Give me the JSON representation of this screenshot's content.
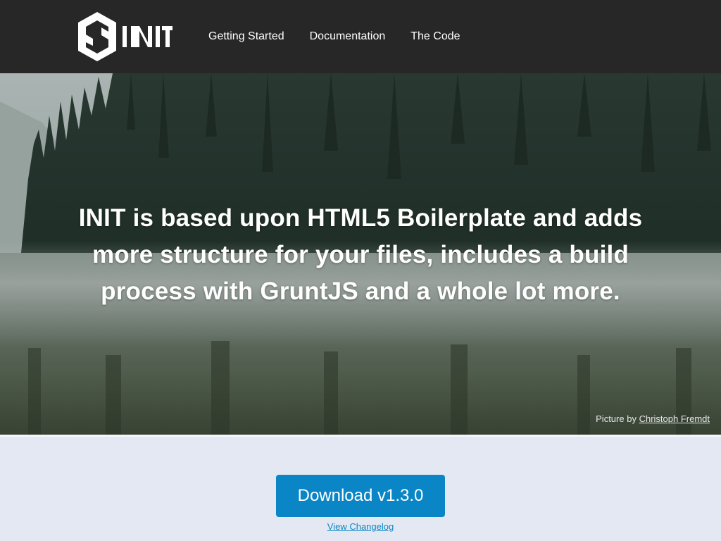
{
  "brand": {
    "logo_text": "INIT"
  },
  "nav": {
    "items": [
      {
        "label": "Getting Started"
      },
      {
        "label": "Documentation"
      },
      {
        "label": "The Code"
      }
    ]
  },
  "hero": {
    "headline": "INIT is based upon HTML5 Boilerplate and adds more structure for your files, includes a build process with GruntJS and a whole lot more.",
    "credit_prefix": "Picture by",
    "credit_author": "Christoph Fremdt"
  },
  "download": {
    "button_label": "Download v1.3.0",
    "changelog_label": "View Changelog"
  },
  "colors": {
    "header_bg": "#272727",
    "accent": "#0a86c6",
    "footer_bg": "#e3e8f2"
  },
  "icons": {
    "logo": "init-hexagon-logo-icon"
  }
}
